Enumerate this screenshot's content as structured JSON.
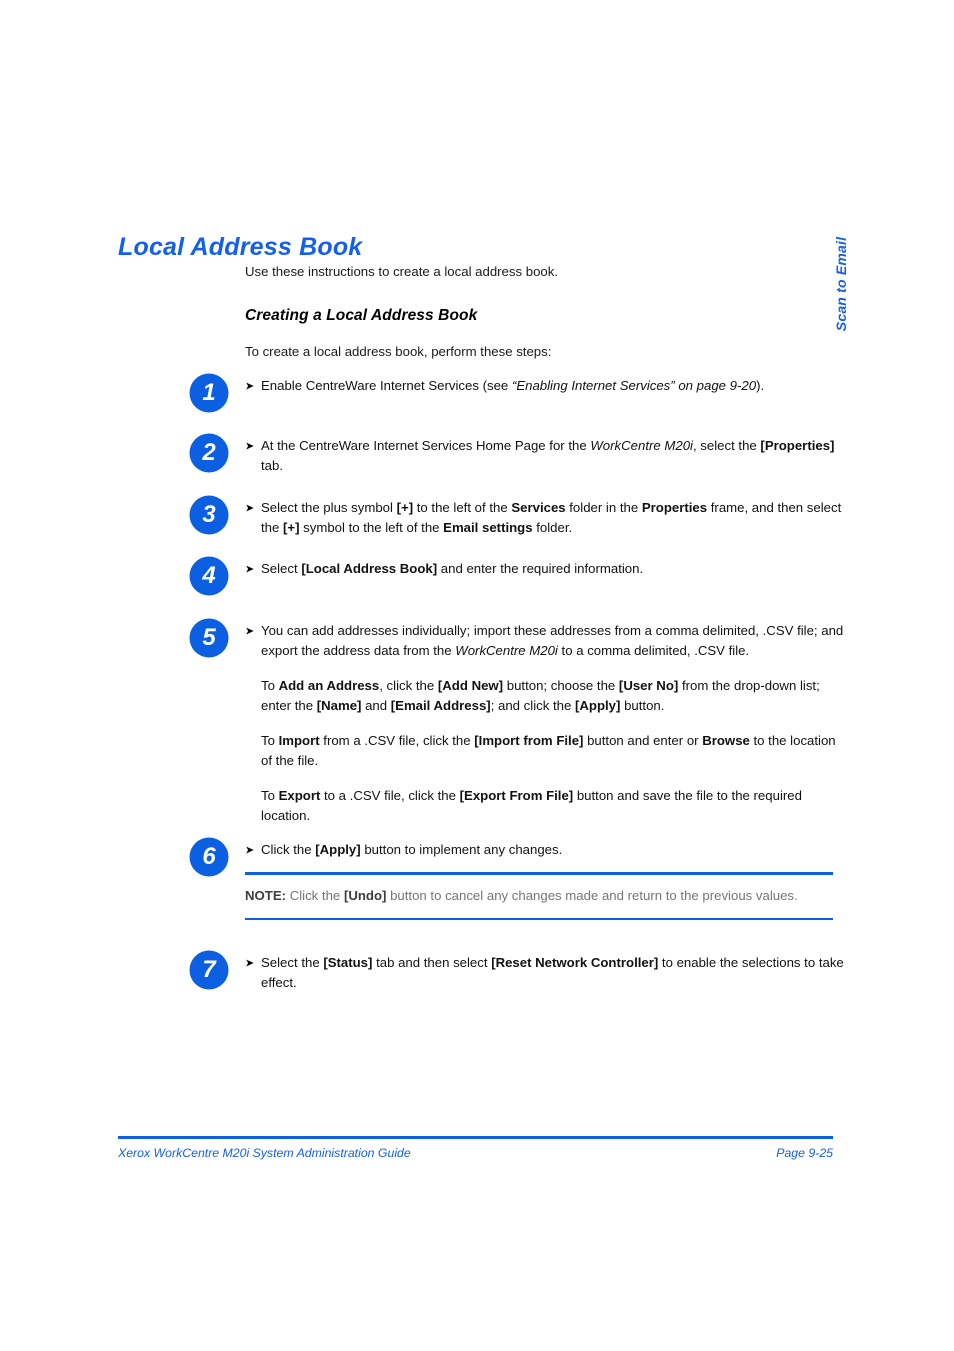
{
  "heading": "Local Address Book",
  "intro": "Use these instructions to create a local address book.",
  "sub_heading": "Creating a Local Address Book",
  "lead": "To create a local address book, perform these steps:",
  "bullet_glyph": "➤",
  "colors": {
    "accent_blue": "#1560E8",
    "badge_blue": "#0B5FE0",
    "rule_blue": "#0B5FE0",
    "note_gray": "#757575"
  },
  "steps": [
    {
      "number": "1",
      "text_html": "Enable CentreWare Internet Services (see <i>“Enabling Internet Services” on page 9-20</i>)."
    },
    {
      "number": "2",
      "text_html": "At the CentreWare Internet Services Home Page for the <i>WorkCentre M20i</i>, select the <b>[Properties]</b> tab."
    },
    {
      "number": "3",
      "text_html": "Select the plus symbol <b>[+]</b> to the left of the <b>Services</b> folder in the <b>Properties</b> frame, and then select the <b>[+]</b> symbol to the left of the <b>Email settings</b> folder."
    },
    {
      "number": "4",
      "text_html": "Select <b>[Local Address Book]</b> and enter the required information."
    },
    {
      "number": "5",
      "text_html": "You can add addresses individually; import these addresses from a comma delimited, .CSV file; and export the address data from the <i>WorkCentre M20i</i> to a comma delimited, .CSV file.",
      "sub_paragraphs_html": [
        "To <b>Add an Address</b>, click the <b>[Add New]</b> button; choose the <b>[User No]</b> from the drop-down list; enter the <b>[Name]</b> and <b>[Email Address]</b>; and click the <b>[Apply]</b> button.",
        "To <b>Import</b> from a .CSV file, click the <b>[Import from File]</b> button and enter or <b>Browse</b> to the location of the file.",
        "To <b>Export</b> to a .CSV file, click the <b>[Export From File]</b> button and save the file to the required location."
      ]
    },
    {
      "number": "6",
      "text_html": "Click the <b>[Apply]</b> button to implement any changes."
    },
    {
      "number": "7",
      "text_html": "Select the <b>[Status]</b> tab and then select <b>[Reset Network Controller]</b> to enable the selections to take effect."
    }
  ],
  "note": {
    "label": "NOTE:",
    "before_key": " Click the ",
    "key": "[Undo]",
    "after_key": " button to cancel any changes made and return to the previous values."
  },
  "side_tab": {
    "label": "Scan to Email"
  },
  "footer": {
    "left": "Xerox WorkCentre M20i System Administration Guide",
    "right": "Page 9-25"
  }
}
